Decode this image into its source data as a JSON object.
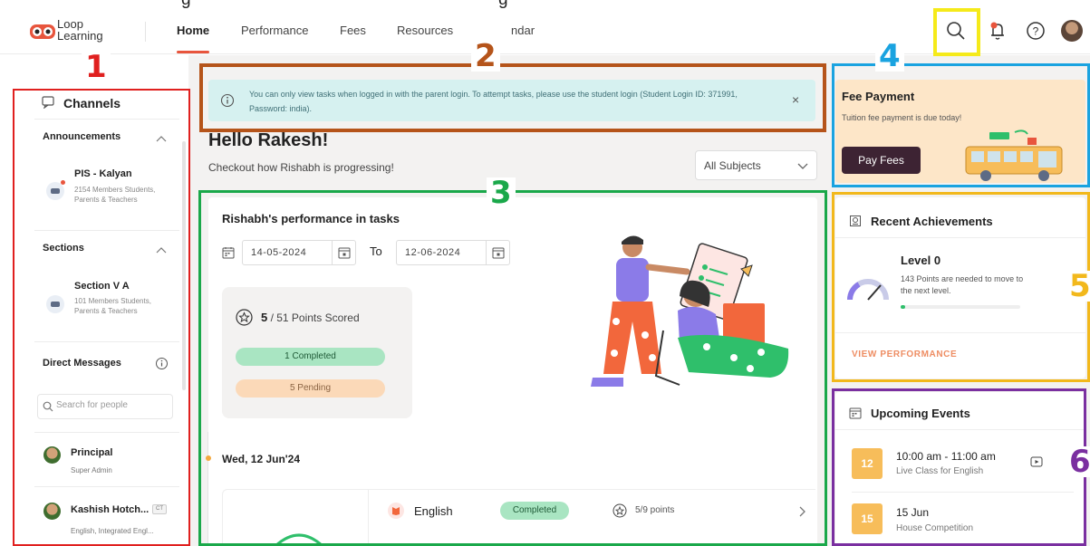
{
  "app": {
    "brand": "Loop Learning",
    "nav": [
      {
        "label": "Home",
        "active": true
      },
      {
        "label": "Performance"
      },
      {
        "label": "Fees"
      },
      {
        "label": "Resources"
      },
      {
        "label": "ndar"
      }
    ],
    "icons": [
      "search-icon",
      "bell-icon",
      "help-icon",
      "profile-avatar"
    ]
  },
  "sidebar": {
    "title": "Channels",
    "announcements_label": "Announcements",
    "announcements": [
      {
        "name": "PIS - Kalyan",
        "meta": "2154 Members Students, Parents & Teachers"
      }
    ],
    "sections_label": "Sections",
    "sections": [
      {
        "name": "Section V A",
        "meta": "101 Members Students, Parents & Teachers"
      }
    ],
    "dm_label": "Direct Messages",
    "dm_search_placeholder": "Search for people",
    "people": [
      {
        "name": "Principal",
        "role": "Super Admin"
      },
      {
        "name": "Kashish Hotch...",
        "role": "English, Integrated Engl...",
        "badge": "CT"
      }
    ]
  },
  "banner": {
    "text": "You can only view tasks when logged in with the parent login. To attempt tasks, please use the student login (Student Login ID: 371991, Password: india).",
    "close": "×"
  },
  "greeting": {
    "title": "Hello Rakesh!",
    "subtitle": "Checkout how Rishabh is progressing!",
    "subject_filter": "All Subjects"
  },
  "performance": {
    "title": "Rishabh's performance in tasks",
    "from_date": "14-05-2024",
    "to_label": "To",
    "to_date": "12-06-2024",
    "score": "5",
    "score_total": " / 51 Points Scored",
    "completed": "1 Completed",
    "pending": "5 Pending",
    "day": "Wed, 12 Jun'24",
    "task": {
      "subject": "English",
      "status": "Completed",
      "points": "5/9 points"
    }
  },
  "fee": {
    "title": "Fee Payment",
    "subtitle": "Tuition fee payment is due today!",
    "button": "Pay Fees"
  },
  "achievements": {
    "title": "Recent Achievements",
    "level": "Level 0",
    "desc": "143 Points are needed to move to the next level.",
    "progress": 0.04,
    "link": "VIEW PERFORMANCE"
  },
  "events": {
    "title": "Upcoming Events",
    "items": [
      {
        "day": "12",
        "time": "10:00 am - 11:00 am",
        "name": "Live Class for English"
      },
      {
        "day": "15",
        "time": "15 Jun",
        "name": "House Competition"
      }
    ]
  },
  "annotations": {
    "labels": [
      "1",
      "2",
      "3",
      "4",
      "5",
      "6"
    ],
    "colors": {
      "1": "#e0201f",
      "2": "#b5541a",
      "3": "#1aa84a",
      "4": "#1aa3e0",
      "5": "#f2b81c",
      "6": "#7a2fa0",
      "search": "#f5ea1a"
    }
  },
  "colors": {
    "accent": "#e8553d",
    "banner_bg": "#d6f1f0",
    "fee_button": "#3d2333",
    "completed": "#a9e5c2",
    "pending": "#fbd9b8",
    "event_date": "#f7bd5a"
  }
}
